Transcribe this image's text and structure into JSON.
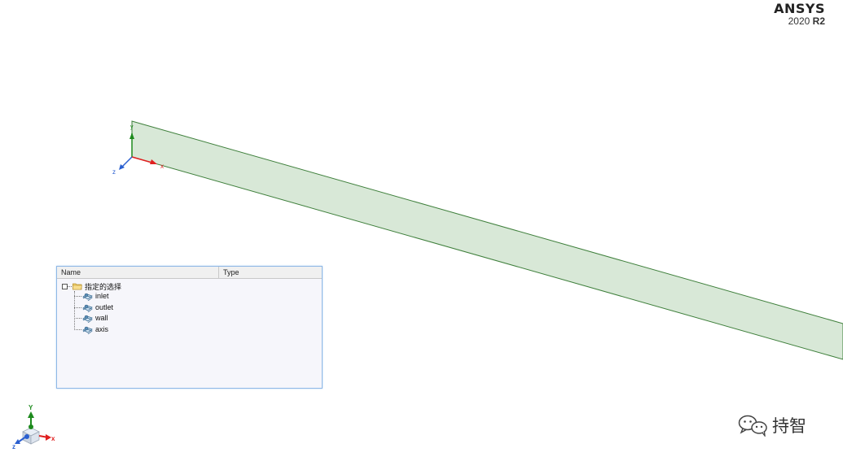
{
  "branding": {
    "product": "ANSYS",
    "version": "2020",
    "release": "R2"
  },
  "viewport": {
    "geometry": "green-rectangular-domain",
    "axes": {
      "x": "x",
      "y": "y",
      "z": "z"
    },
    "colors": {
      "fill": "#d8e8d7",
      "edge": "#3e7f3b",
      "x_axis": "#e02020",
      "y_axis": "#1d8a1d",
      "z_axis": "#2a5fd0"
    }
  },
  "selection_tree": {
    "columns": {
      "name": "Name",
      "type": "Type"
    },
    "root": {
      "label": "指定的选择",
      "icon": "folder-icon"
    },
    "items": [
      {
        "label": "inlet",
        "icon": "face-selection-icon"
      },
      {
        "label": "outlet",
        "icon": "face-selection-icon"
      },
      {
        "label": "wall",
        "icon": "face-selection-icon"
      },
      {
        "label": "axis",
        "icon": "face-selection-icon"
      }
    ]
  },
  "orientation_triad": {
    "x": "x",
    "y": "Y",
    "z": "z"
  },
  "watermark": {
    "text": "持智",
    "icon": "wechat-icon"
  }
}
